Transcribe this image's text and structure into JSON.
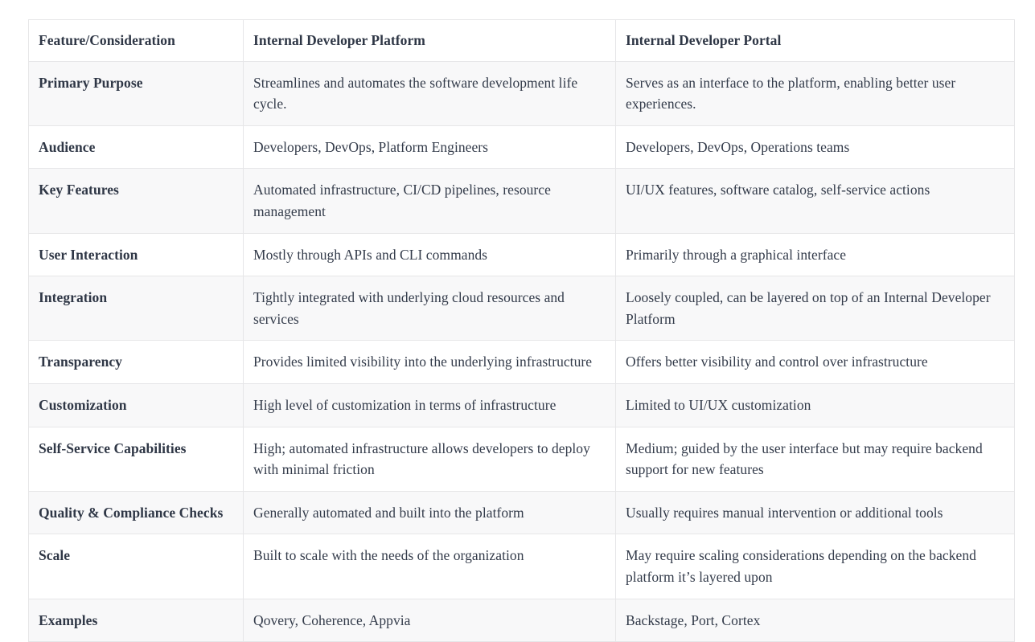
{
  "table": {
    "name": "idp-comparison-table",
    "columns": [
      "Feature/Consideration",
      "Internal Developer Platform",
      "Internal Developer Portal"
    ],
    "rows": [
      {
        "feature": "Primary Purpose",
        "platform": "Streamlines and automates the software development life cycle.",
        "portal": "Serves as an interface to the platform, enabling better user experiences.",
        "tall": true
      },
      {
        "feature": "Audience",
        "platform": "Developers, DevOps, Platform Engineers",
        "portal": "Developers, DevOps, Operations teams",
        "tall": false
      },
      {
        "feature": "Key Features",
        "platform": "Automated infrastructure, CI/CD pipelines, resource management",
        "portal": "UI/UX features, software catalog, self-service actions",
        "tall": true
      },
      {
        "feature": "User Interaction",
        "platform": "Mostly through APIs and CLI commands",
        "portal": "Primarily through a graphical interface",
        "tall": false
      },
      {
        "feature": "Integration",
        "platform": "Tightly integrated with underlying cloud resources and services",
        "portal": "Loosely coupled, can be layered on top of an Internal Developer Platform",
        "tall": true
      },
      {
        "feature": "Transparency",
        "platform": "Provides limited visibility into the underlying infrastructure",
        "portal": "Offers better visibility and control over infrastructure",
        "tall": true
      },
      {
        "feature": "Customization",
        "platform": "High level of customization in terms of infrastructure",
        "portal": "Limited to UI/UX customization",
        "tall": false
      },
      {
        "feature": "Self-Service Capabilities",
        "platform": "High; automated infrastructure allows developers to deploy with minimal friction",
        "portal": "Medium; guided by the user interface but may require backend support for new features",
        "tall": true
      },
      {
        "feature": "Quality & Compliance Checks",
        "platform": "Generally automated and built into the platform",
        "portal": "Usually requires manual intervention or additional tools",
        "tall": true
      },
      {
        "feature": "Scale",
        "platform": "Built to scale with the needs of the organization",
        "portal": "May require scaling considerations depending on the backend platform it’s layered upon",
        "tall": true
      },
      {
        "feature": "Examples",
        "platform": "Qovery, Coherence, Appvia",
        "portal": "Backstage, Port, Cortex",
        "tall": false
      }
    ]
  },
  "colors": {
    "text": "#333b4a",
    "heading": "#2f3746",
    "border": "#e6e6e8",
    "row_alt_background": "#f8f8f9",
    "row_background": "#ffffff",
    "page_background": "#ffffff"
  }
}
